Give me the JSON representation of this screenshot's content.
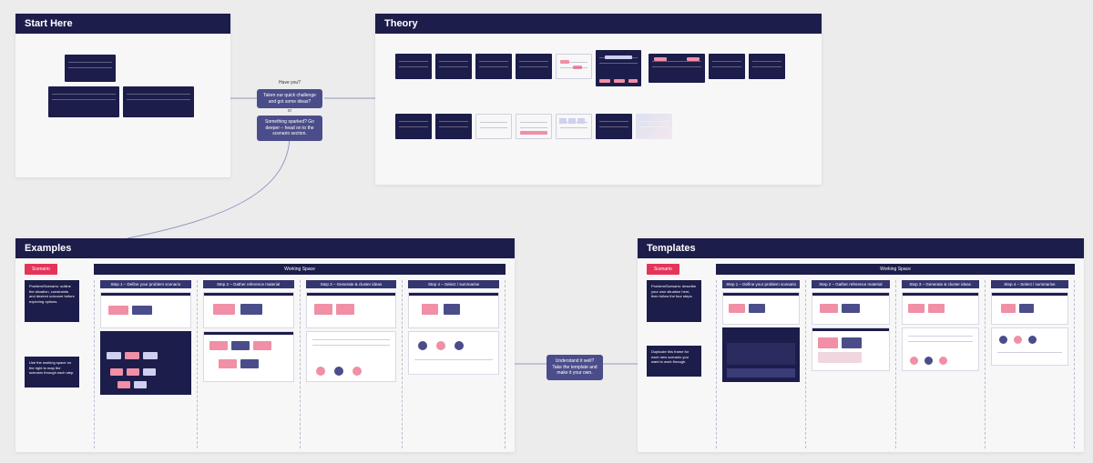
{
  "panels": {
    "start": {
      "title": "Start Here"
    },
    "theory": {
      "title": "Theory"
    },
    "examples": {
      "title": "Examples",
      "tag_label": "Scenario",
      "working_space_label": "Working Space",
      "info1_text": "Problem/Scenario: outline the situation, constraints and desired outcome before exploring options.",
      "info2_text": "Use the working space on the right to map the scenario through each step.",
      "steps": [
        "Step 1 – Define your problem scenario",
        "Step 2 – Gather reference material",
        "Step 3 – Generate & cluster ideas",
        "Step 4 – Select / summarise"
      ]
    },
    "templates": {
      "title": "Templates",
      "tag_label": "Scenario",
      "working_space_label": "Working Space",
      "info1_text": "Problem/Scenario: describe your own situation here, then follow the four steps.",
      "info2_text": "Duplicate this frame for each new scenario you want to work through.",
      "steps": [
        "Step 1 – Define your problem scenario",
        "Step 2 – Gather reference material",
        "Step 3 – Generate & cluster ideas",
        "Step 4 – Select / summarise"
      ]
    }
  },
  "decision": {
    "heading": "Have you?",
    "option_a": "Taken our quick challenge and got some ideas?",
    "or": "or",
    "option_b": "Something sparked? Go deeper – head on to the scenario section."
  },
  "connector_to_templates": "Understand it well? Take the template and make it your own."
}
